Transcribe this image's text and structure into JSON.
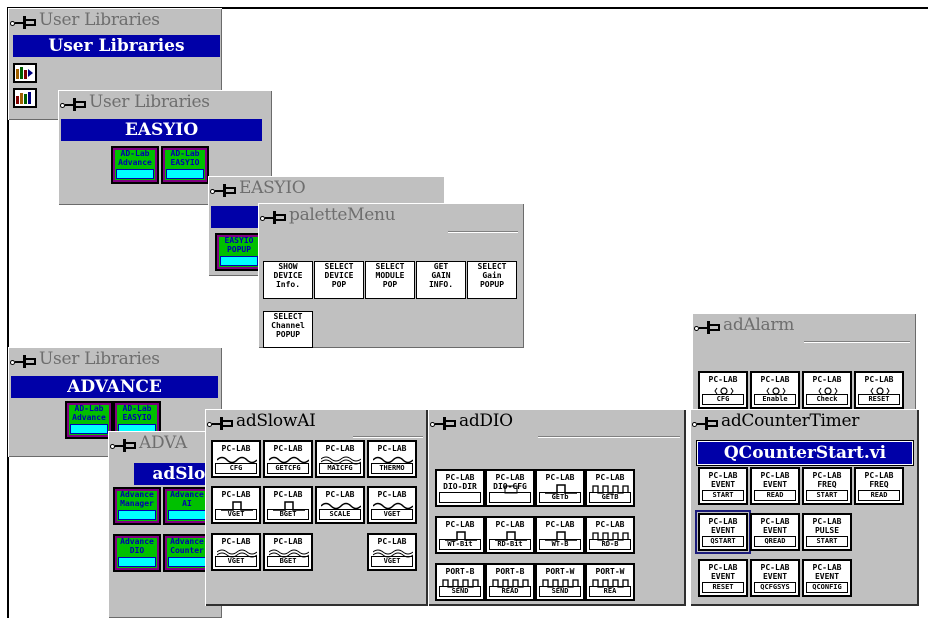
{
  "windows": {
    "user_libraries_1": {
      "title": "User Libraries",
      "header": "User Libraries"
    },
    "user_libraries_2": {
      "title": "User Libraries",
      "header": "EASYIO",
      "buttons": [
        {
          "line1": "AD-Lab",
          "line2": "Advance"
        },
        {
          "line1": "AD-Lab",
          "line2": "EASYIO"
        }
      ]
    },
    "easyio": {
      "title": "EASYIO",
      "buttons": [
        {
          "line1": "EASYIO",
          "line2": "POPUP"
        }
      ]
    },
    "palette_menu": {
      "title": "paletteMenu",
      "buttons": [
        {
          "text": "SHOW\nDEVICE\nInfo."
        },
        {
          "text": "SELECT\nDEVICE\nPOP"
        },
        {
          "text": "SELECT\nMODULE\nPOP"
        },
        {
          "text": "GET\nGAIN\nINFO."
        },
        {
          "text": "SELECT\nGain\nPOPUP"
        },
        {
          "text": "SELECT\nChannel\nPOPUP"
        }
      ]
    },
    "user_libraries_3": {
      "title": "User Libraries",
      "header": "ADVANCE",
      "buttons": [
        {
          "line1": "AD-Lab",
          "line2": "Advance"
        },
        {
          "line1": "AD-Lab",
          "line2": "EASYIO"
        }
      ]
    },
    "advance": {
      "title": "ADVA",
      "header": "adSlow",
      "buttons": [
        {
          "line1": "Advance",
          "line2": "Manager"
        },
        {
          "line1": "Advance",
          "line2": "AI"
        },
        {
          "line1": "Advance",
          "line2": "DIO"
        },
        {
          "line1": "Advance",
          "line2": "Counter"
        }
      ]
    },
    "ad_slow_ai": {
      "title": "adSlowAI",
      "buttons": [
        {
          "top": "PC-LAB",
          "bottom": "CFG"
        },
        {
          "top": "PC-LAB",
          "bottom": "GETCFG"
        },
        {
          "top": "PC-LAB",
          "bottom": "MAICFG"
        },
        {
          "top": "PC-LAB",
          "bottom": "THERMO"
        },
        {
          "top": "PC-LAB",
          "bottom": "VGET"
        },
        {
          "top": "PC-LAB",
          "bottom": "BGET"
        },
        {
          "top": "PC-LAB",
          "bottom": "SCALE"
        },
        {
          "top": "PC-LAB",
          "bottom": "VGET"
        },
        {
          "top": "PC-LAB",
          "bottom": "VGET"
        },
        {
          "top": "PC-LAB",
          "bottom": "BGET"
        },
        {
          "top": "PC-LAB",
          "bottom": "VGET"
        }
      ]
    },
    "ad_dio": {
      "title": "adDIO",
      "buttons": [
        {
          "top": "PC-LAB",
          "mid": "DIO-DIR",
          "bottom": ""
        },
        {
          "top": "PC-LAB",
          "mid": "DIO-CFG",
          "bottom": ""
        },
        {
          "top": "PC-LAB",
          "mid": "",
          "bottom": "GETb"
        },
        {
          "top": "PC-LAB",
          "mid": "",
          "bottom": "GETB"
        },
        {
          "top": "PC-LAB",
          "mid": "",
          "bottom": "WT-Bit"
        },
        {
          "top": "PC-LAB",
          "mid": "",
          "bottom": "RD-Bit"
        },
        {
          "top": "PC-LAB",
          "mid": "",
          "bottom": "WT-B"
        },
        {
          "top": "PC-LAB",
          "mid": "",
          "bottom": "RD-B"
        },
        {
          "top": "PORT-B",
          "mid": "",
          "bottom": "SEND"
        },
        {
          "top": "PORT-B",
          "mid": "",
          "bottom": "READ"
        },
        {
          "top": "PORT-W",
          "mid": "",
          "bottom": "SEND"
        },
        {
          "top": "PORT-W",
          "mid": "",
          "bottom": "REA"
        }
      ]
    },
    "ad_alarm": {
      "title": "adAlarm",
      "buttons": [
        {
          "top": "PC-LAB",
          "bottom": "CFG"
        },
        {
          "top": "PC-LAB",
          "bottom": "Enable"
        },
        {
          "top": "PC-LAB",
          "bottom": "Check"
        },
        {
          "top": "PC-LAB",
          "bottom": "RESET"
        }
      ]
    },
    "ad_count_timer": {
      "title": "adCounterTimer",
      "header": "QCounterStart.vi",
      "buttons": [
        {
          "l1": "PC-LAB",
          "l2": "EVENT",
          "bottom": "START"
        },
        {
          "l1": "PC-LAB",
          "l2": "EVENT",
          "bottom": "READ"
        },
        {
          "l1": "PC-LAB",
          "l2": "FREQ",
          "bottom": "START"
        },
        {
          "l1": "PC-LAB",
          "l2": "FREQ",
          "bottom": "READ"
        },
        {
          "l1": "PC-LAB",
          "l2": "EVENT",
          "bottom": "QSTART"
        },
        {
          "l1": "PC-LAB",
          "l2": "EVENT",
          "bottom": "QREAD"
        },
        {
          "l1": "PC-LAB",
          "l2": "PULSE",
          "bottom": "START"
        },
        {
          "l1": "PC-LAB",
          "l2": "EVENT",
          "bottom": "RESET"
        },
        {
          "l1": "PC-LAB",
          "l2": "EVENT",
          "bottom": "QCFGSYS"
        },
        {
          "l1": "PC-LAB",
          "l2": "EVENT",
          "bottom": "QCONFIG"
        }
      ]
    }
  },
  "colors": {
    "window": "#c0c0c0",
    "header_blue": "#0000a8",
    "advance_purple": "#800080",
    "advance_green": "#00c000",
    "advance_cyan": "#00ffff"
  }
}
